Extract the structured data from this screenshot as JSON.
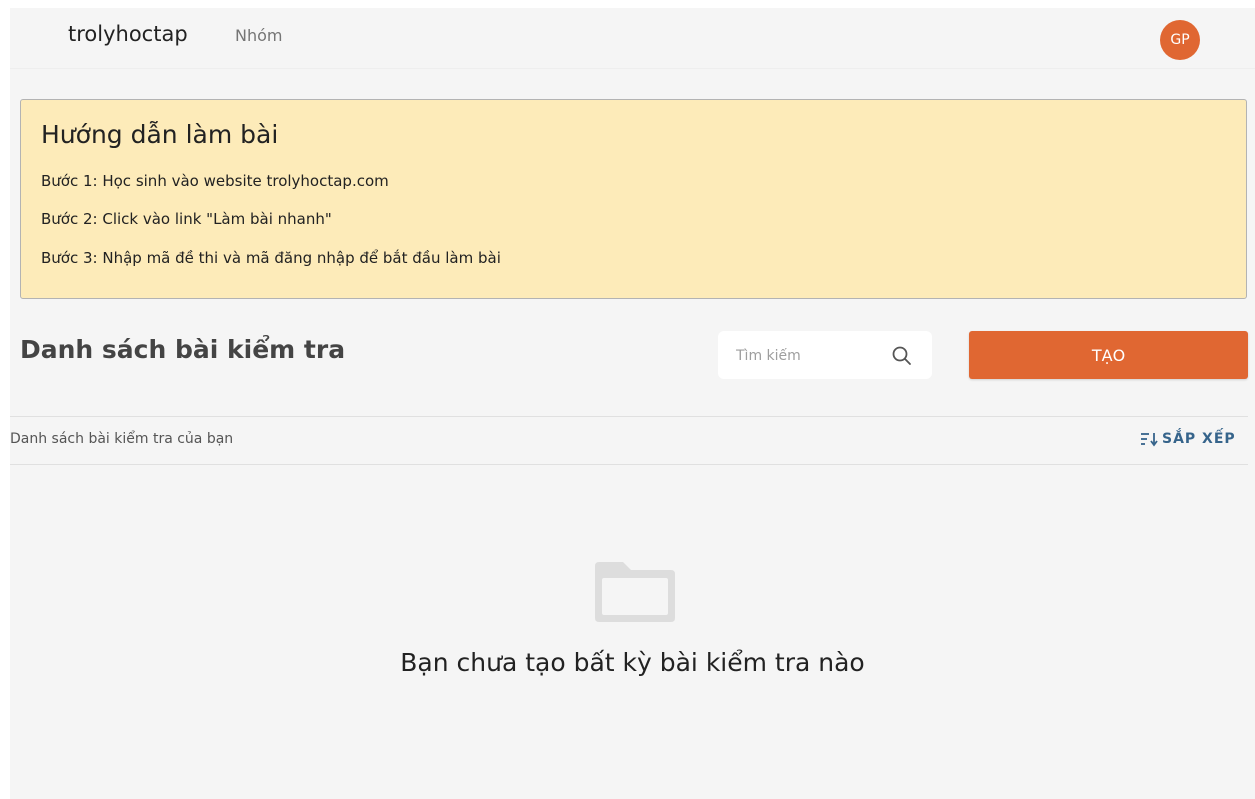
{
  "header": {
    "brand": "trolyhoctap",
    "nav_groups": "Nhóm",
    "avatar_initials": "GP"
  },
  "guide": {
    "title": "Hướng dẫn làm bài",
    "steps": [
      "Bước 1: Học sinh vào website trolyhoctap.com",
      "Bước 2: Click vào link \"Làm bài nhanh\"",
      "Bước 3: Nhập mã đề thi và mã đăng nhập để bắt đầu làm bài"
    ]
  },
  "list": {
    "title": "Danh sách bài kiểm tra",
    "search_placeholder": "Tìm kiếm",
    "create_label": "TẠO",
    "subheading": "Danh sách bài kiểm tra của bạn",
    "sort_label": "SẮP XẾP"
  },
  "empty_state": {
    "icon": "folder-icon",
    "message": "Bạn chưa tạo bất kỳ bài kiểm tra nào"
  },
  "colors": {
    "accent": "#e06732",
    "guide_background": "#fdebb9",
    "sort_link": "#36648b",
    "page_background": "#f5f5f5"
  }
}
